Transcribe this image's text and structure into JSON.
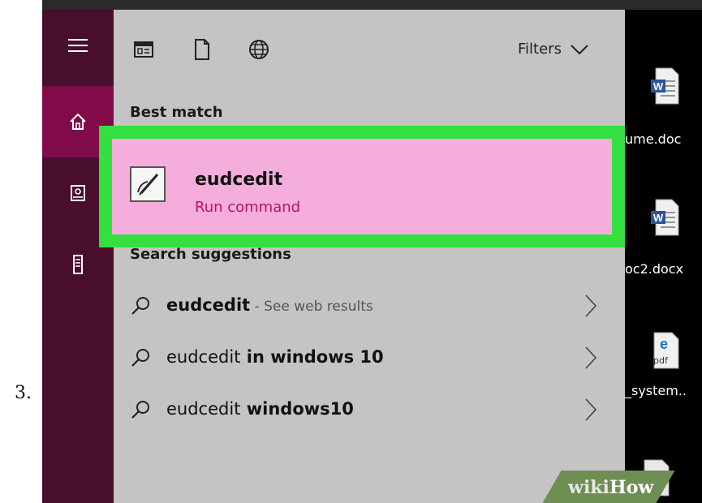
{
  "step_number": "3.",
  "toolbar": {
    "filters_label": "Filters"
  },
  "best_match": {
    "section_label": "Best match",
    "app_name": "eudcedit",
    "app_type": "Run command"
  },
  "suggestions": {
    "section_label": "Search suggestions",
    "items": [
      {
        "query": "eudcedit",
        "suffix": " - See web results",
        "suffix_style": "muted"
      },
      {
        "query": "eudcedit",
        "suffix": " in windows 10",
        "suffix_style": "bold"
      },
      {
        "query": "eudcedit",
        "suffix": " windows10",
        "suffix_style": "bold"
      }
    ]
  },
  "desktop": {
    "files": [
      {
        "label": "ume.doc"
      },
      {
        "label": "oc2.docx"
      },
      {
        "label": "_system..",
        "badge": "pdf"
      }
    ]
  },
  "watermark": {
    "wiki": "wiki",
    "how": "How"
  },
  "colors": {
    "sidebar": "#4a0e2d",
    "sidebar_active": "#800a4a",
    "panel": "#c4c4c4",
    "highlight_border": "#33e040",
    "match_background": "#f5aedb",
    "accent_text": "#b8126a"
  },
  "icons": {
    "sidebar": [
      "hamburger-menu-icon",
      "home-icon",
      "notebook-icon",
      "tower-device-icon"
    ],
    "toolbar": [
      "apps-icon",
      "documents-icon",
      "web-globe-icon"
    ],
    "filters": "chevron-down-icon",
    "suggestion": "search-icon",
    "suggestion_action": "chevron-right-icon"
  }
}
